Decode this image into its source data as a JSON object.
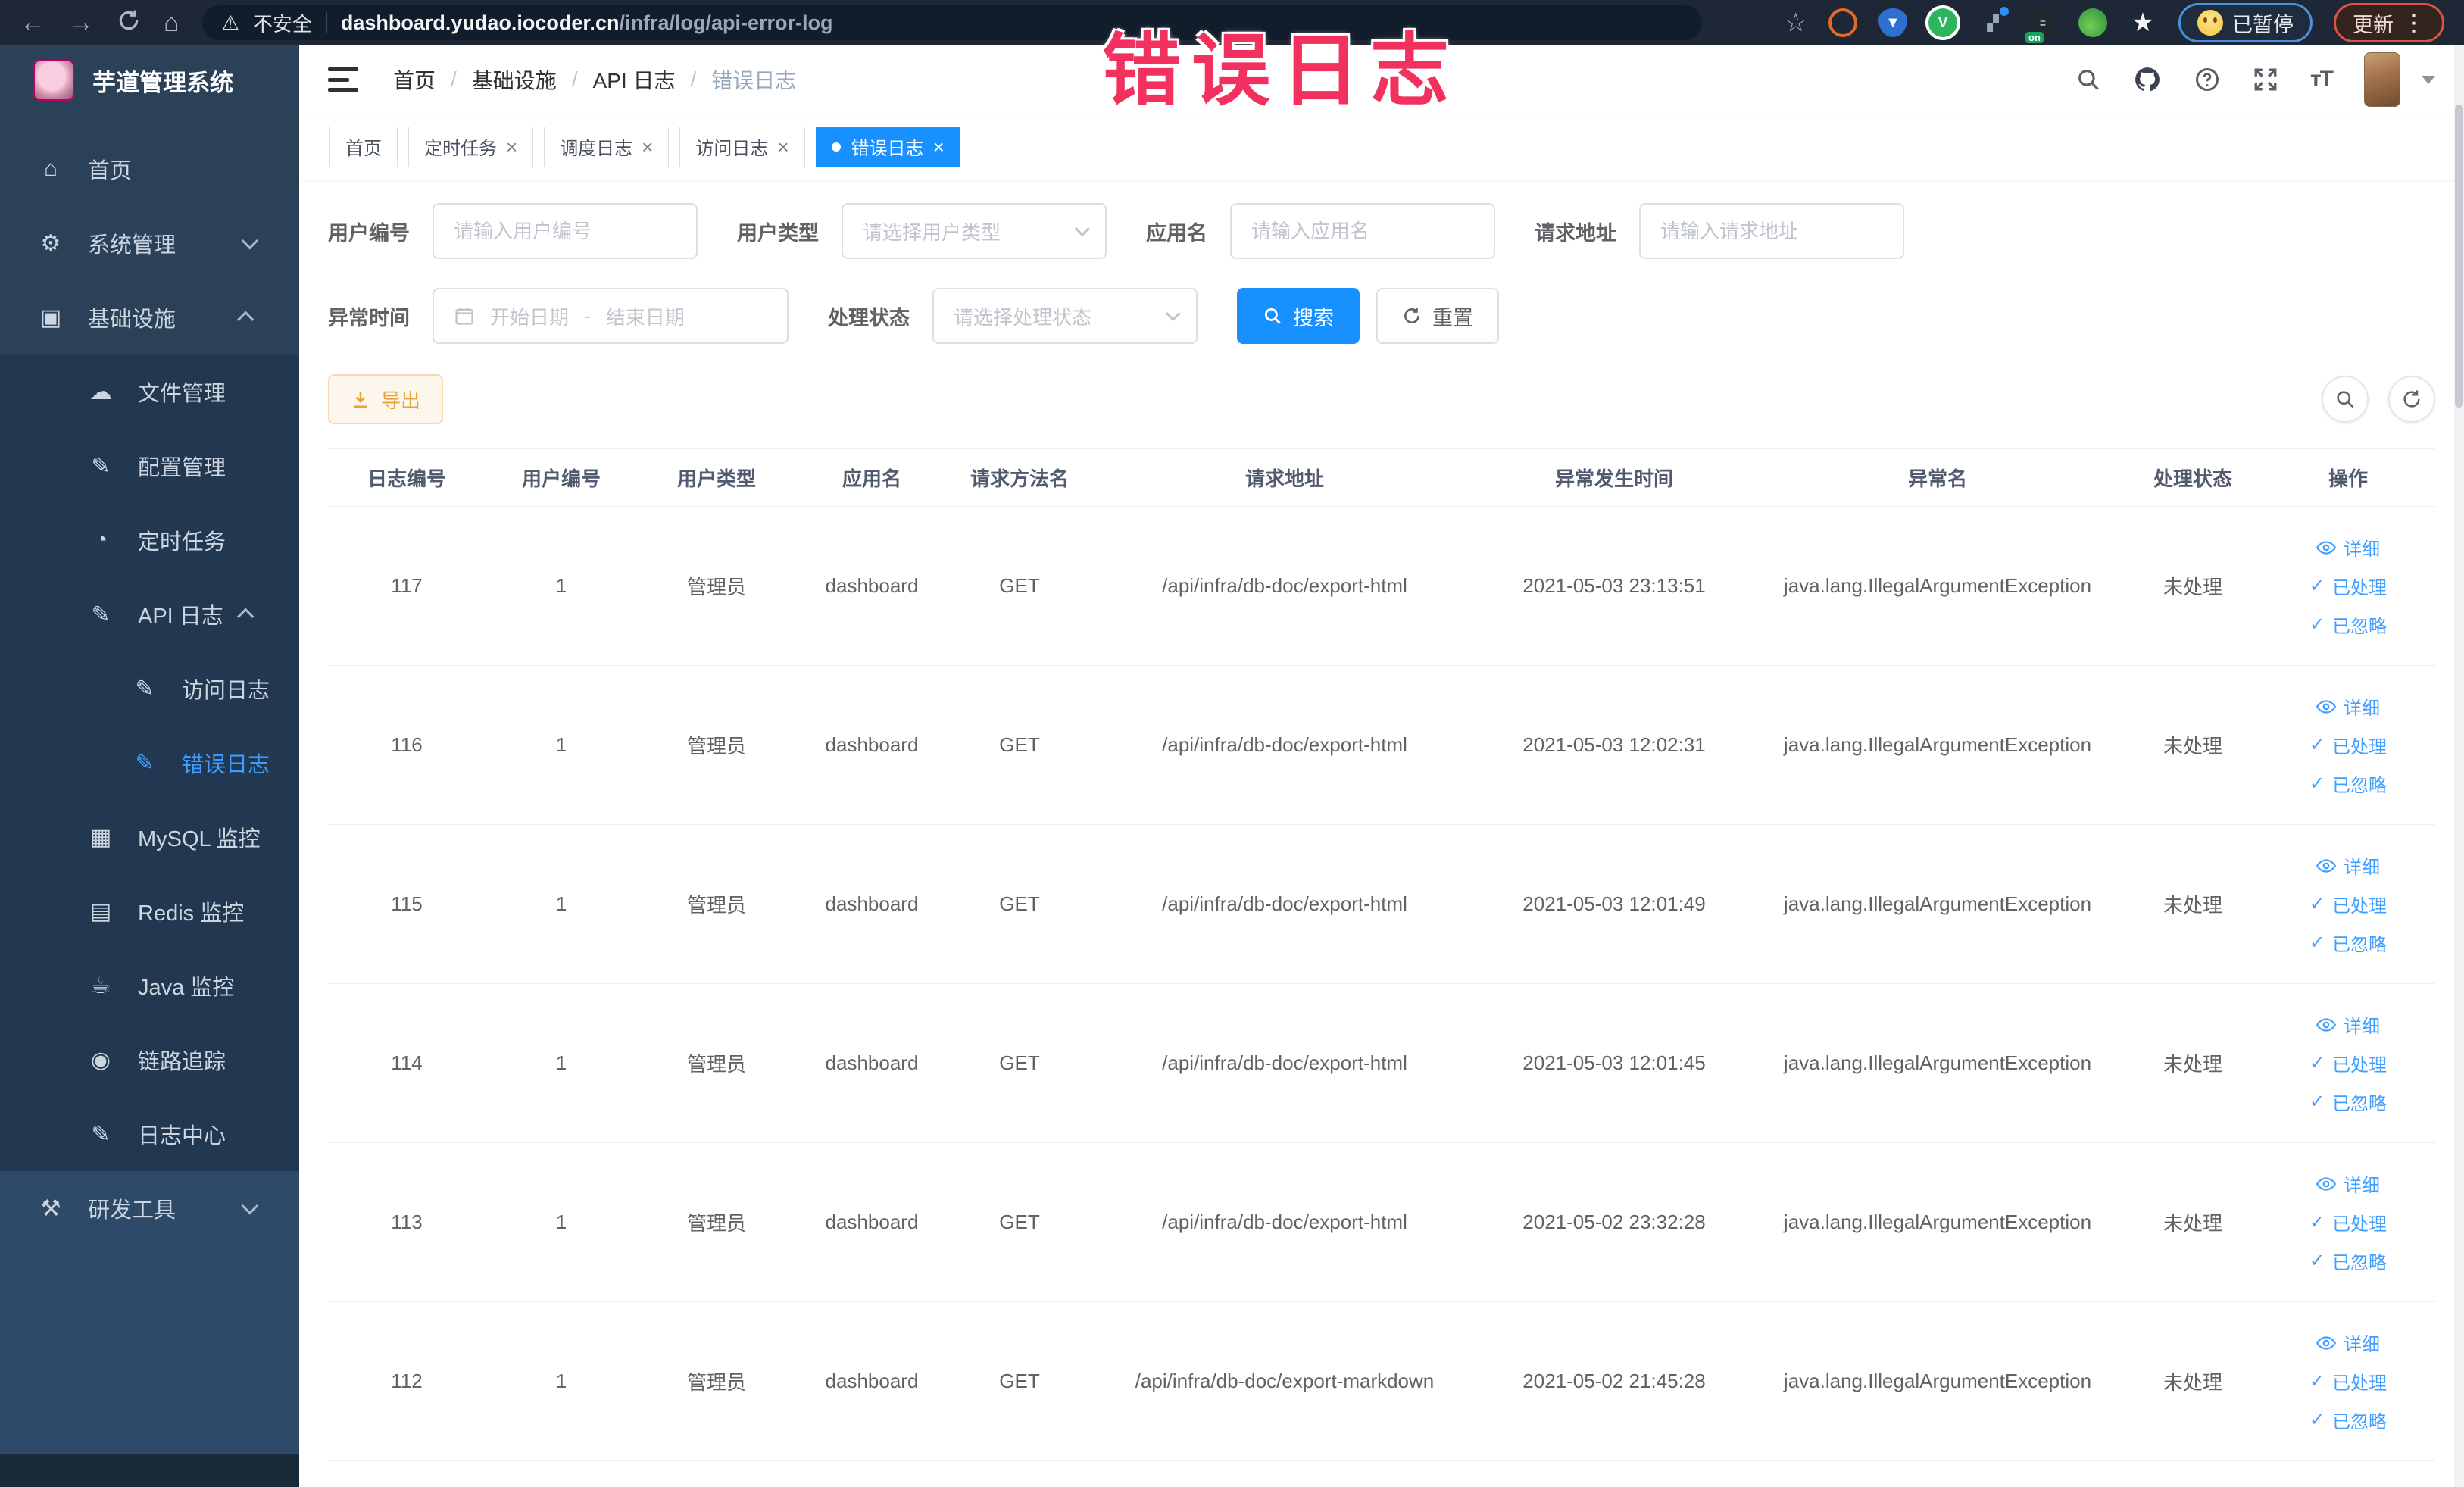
{
  "browser": {
    "security_label": "不安全",
    "url_domain": "dashboard.yudao.iocoder.cn",
    "url_path": "/infra/log/api-error-log",
    "extensions_on_label": "on",
    "paused_badge": "已暂停",
    "update_button": "更新"
  },
  "annotation": {
    "text": "错误日志",
    "color": "#f2315e"
  },
  "icons": {
    "back": "←",
    "forward": "→",
    "home": "⌂",
    "warning": "⚠",
    "star": "☆",
    "dots": "⋮",
    "close": "×",
    "check": "✓",
    "home-menu": "⌂",
    "gear": "⚙",
    "infra": "▣",
    "cloud": "☁",
    "edit": "✎",
    "timer": "◔",
    "log": "✎",
    "mysql": "▦",
    "redis": "▤",
    "java": "☕",
    "trace": "◉",
    "tool": "⚒"
  },
  "sidebar": {
    "logo_title": "芋道管理系统",
    "items": [
      {
        "key": "home",
        "label": "首页",
        "icon": "home-menu",
        "level": 0
      },
      {
        "key": "system",
        "label": "系统管理",
        "icon": "gear",
        "level": 0,
        "arrow": "down"
      },
      {
        "key": "infra",
        "label": "基础设施",
        "icon": "infra",
        "level": 0,
        "arrow": "up"
      },
      {
        "key": "file",
        "label": "文件管理",
        "icon": "cloud",
        "level": 1,
        "sub": true
      },
      {
        "key": "config",
        "label": "配置管理",
        "icon": "edit",
        "level": 1,
        "sub": true
      },
      {
        "key": "job",
        "label": "定时任务",
        "icon": "timer",
        "level": 1,
        "sub": true
      },
      {
        "key": "api-log",
        "label": "API 日志",
        "icon": "edit",
        "level": 1,
        "sub": true,
        "arrow": "up"
      },
      {
        "key": "access-log",
        "label": "访问日志",
        "icon": "edit",
        "level": 2,
        "sub": true
      },
      {
        "key": "error-log",
        "label": "错误日志",
        "icon": "edit",
        "level": 2,
        "sub": true,
        "active": true
      },
      {
        "key": "mysql",
        "label": "MySQL 监控",
        "icon": "mysql",
        "level": 1,
        "sub": true
      },
      {
        "key": "redis",
        "label": "Redis 监控",
        "icon": "redis",
        "level": 1,
        "sub": true
      },
      {
        "key": "java",
        "label": "Java 监控",
        "icon": "java",
        "level": 1,
        "sub": true
      },
      {
        "key": "trace",
        "label": "链路追踪",
        "icon": "trace",
        "level": 1,
        "sub": true
      },
      {
        "key": "log-center",
        "label": "日志中心",
        "icon": "log",
        "level": 1,
        "sub": true
      },
      {
        "key": "dev-tools",
        "label": "研发工具",
        "icon": "tool",
        "level": 0,
        "arrow": "down",
        "section": "light"
      }
    ]
  },
  "breadcrumb": {
    "separator": "/",
    "items": [
      "首页",
      "基础设施",
      "API 日志",
      "错误日志"
    ]
  },
  "tabs": [
    {
      "label": "首页",
      "closable": false,
      "active": false
    },
    {
      "label": "定时任务",
      "closable": true,
      "active": false
    },
    {
      "label": "调度日志",
      "closable": true,
      "active": false
    },
    {
      "label": "访问日志",
      "closable": true,
      "active": false
    },
    {
      "label": "错误日志",
      "closable": true,
      "active": true
    }
  ],
  "filters": {
    "user_id": {
      "label": "用户编号",
      "placeholder": "请输入用户编号"
    },
    "user_type": {
      "label": "用户类型",
      "placeholder": "请选择用户类型"
    },
    "app_name": {
      "label": "应用名",
      "placeholder": "请输入应用名"
    },
    "request_url": {
      "label": "请求地址",
      "placeholder": "请输入请求地址"
    },
    "exception_time": {
      "label": "异常时间",
      "start_placeholder": "开始日期",
      "separator": "-",
      "end_placeholder": "结束日期"
    },
    "process_status": {
      "label": "处理状态",
      "placeholder": "请选择处理状态"
    },
    "search_button": "搜索",
    "reset_button": "重置"
  },
  "toolbar": {
    "export_button": "导出"
  },
  "table": {
    "columns": [
      "日志编号",
      "用户编号",
      "用户类型",
      "应用名",
      "请求方法名",
      "请求地址",
      "异常发生时间",
      "异常名",
      "处理状态",
      "操作"
    ],
    "actions": [
      "详细",
      "已处理",
      "已忽略"
    ],
    "rows": [
      {
        "id": "117",
        "user_id": "1",
        "user_type": "管理员",
        "app": "dashboard",
        "method": "GET",
        "url": "/api/infra/db-doc/export-html",
        "time": "2021-05-03 23:13:51",
        "exception": "java.lang.IllegalArgumentException",
        "status": "未处理"
      },
      {
        "id": "116",
        "user_id": "1",
        "user_type": "管理员",
        "app": "dashboard",
        "method": "GET",
        "url": "/api/infra/db-doc/export-html",
        "time": "2021-05-03 12:02:31",
        "exception": "java.lang.IllegalArgumentException",
        "status": "未处理"
      },
      {
        "id": "115",
        "user_id": "1",
        "user_type": "管理员",
        "app": "dashboard",
        "method": "GET",
        "url": "/api/infra/db-doc/export-html",
        "time": "2021-05-03 12:01:49",
        "exception": "java.lang.IllegalArgumentException",
        "status": "未处理"
      },
      {
        "id": "114",
        "user_id": "1",
        "user_type": "管理员",
        "app": "dashboard",
        "method": "GET",
        "url": "/api/infra/db-doc/export-html",
        "time": "2021-05-03 12:01:45",
        "exception": "java.lang.IllegalArgumentException",
        "status": "未处理"
      },
      {
        "id": "113",
        "user_id": "1",
        "user_type": "管理员",
        "app": "dashboard",
        "method": "GET",
        "url": "/api/infra/db-doc/export-html",
        "time": "2021-05-02 23:32:28",
        "exception": "java.lang.IllegalArgumentException",
        "status": "未处理"
      },
      {
        "id": "112",
        "user_id": "1",
        "user_type": "管理员",
        "app": "dashboard",
        "method": "GET",
        "url": "/api/infra/db-doc/export-markdown",
        "time": "2021-05-02 21:45:28",
        "exception": "java.lang.IllegalArgumentException",
        "status": "未处理"
      }
    ]
  }
}
